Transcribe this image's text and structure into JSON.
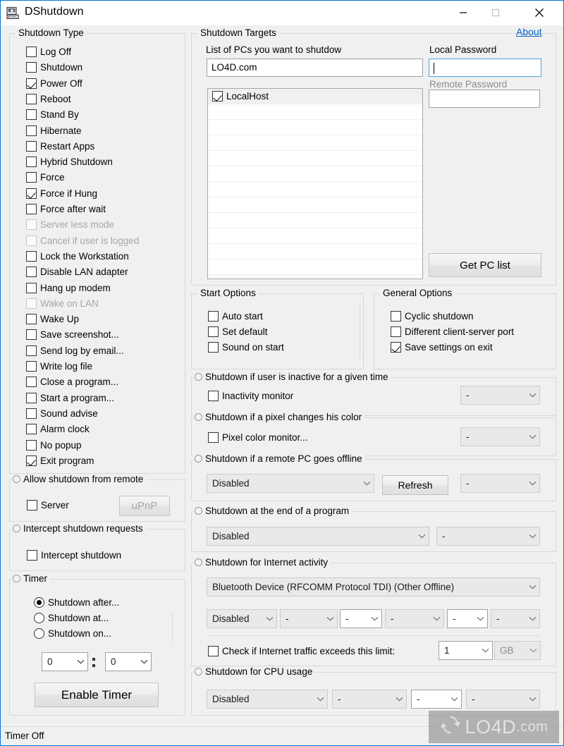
{
  "window": {
    "title": "DShutdown",
    "icon": "computer-icon",
    "minimize_label": "–",
    "maximize_label": "□",
    "close_label": "✕"
  },
  "about_link": "About",
  "shutdown_type": {
    "title": "Shutdown Type",
    "items": [
      {
        "label": "Log Off",
        "checked": false,
        "disabled": false
      },
      {
        "label": "Shutdown",
        "checked": false,
        "disabled": false
      },
      {
        "label": "Power Off",
        "checked": true,
        "disabled": false
      },
      {
        "label": "Reboot",
        "checked": false,
        "disabled": false
      },
      {
        "label": "Stand By",
        "checked": false,
        "disabled": false
      },
      {
        "label": "Hibernate",
        "checked": false,
        "disabled": false
      },
      {
        "label": "Restart Apps",
        "checked": false,
        "disabled": false
      },
      {
        "label": "Hybrid Shutdown",
        "checked": false,
        "disabled": false
      },
      {
        "label": "Force",
        "checked": false,
        "disabled": false
      },
      {
        "label": "Force if Hung",
        "checked": true,
        "disabled": false
      },
      {
        "label": "Force after wait",
        "checked": false,
        "disabled": false
      },
      {
        "label": "Server less mode",
        "checked": false,
        "disabled": true
      },
      {
        "label": "Cancel if user is logged",
        "checked": false,
        "disabled": true
      },
      {
        "label": "Lock the Workstation",
        "checked": false,
        "disabled": false
      },
      {
        "label": "Disable LAN adapter",
        "checked": false,
        "disabled": false
      },
      {
        "label": "Hang up modem",
        "checked": false,
        "disabled": false
      },
      {
        "label": "Wake on LAN",
        "checked": false,
        "disabled": true
      },
      {
        "label": "Wake Up",
        "checked": false,
        "disabled": false
      },
      {
        "label": "Save screenshot...",
        "checked": false,
        "disabled": false
      },
      {
        "label": "Send log by email...",
        "checked": false,
        "disabled": false
      },
      {
        "label": "Write log file",
        "checked": false,
        "disabled": false
      },
      {
        "label": "Close a program...",
        "checked": false,
        "disabled": false
      },
      {
        "label": "Start a program...",
        "checked": false,
        "disabled": false
      },
      {
        "label": "Sound advise",
        "checked": false,
        "disabled": false
      },
      {
        "label": "Alarm clock",
        "checked": false,
        "disabled": false
      },
      {
        "label": "No popup",
        "checked": false,
        "disabled": false
      },
      {
        "label": "Exit program",
        "checked": true,
        "disabled": false
      }
    ]
  },
  "allow_remote": {
    "title": "Allow shutdown from remote",
    "server_label": "Server",
    "server_checked": false,
    "upnp_button": "uPnP",
    "upnp_disabled": true
  },
  "intercept": {
    "title": "Intercept shutdown requests",
    "checkbox_label": "Intercept shutdown",
    "checked": false
  },
  "timer": {
    "title": "Timer",
    "options": [
      {
        "label": "Shutdown after...",
        "selected": true
      },
      {
        "label": "Shutdown at...",
        "selected": false
      },
      {
        "label": "Shutdown on...",
        "selected": false
      }
    ],
    "hours_value": "0",
    "minutes_value": "0",
    "separator": ":",
    "enable_button": "Enable Timer"
  },
  "targets": {
    "title": "Shutdown Targets",
    "list_label": "List of PCs you want to shutdow",
    "pc_input_value": "LO4D.com",
    "local_password_label": "Local Password",
    "local_password_value": "",
    "remote_password_label": "Remote Password",
    "remote_password_value": "",
    "get_pc_list_button": "Get PC list",
    "pc_rows": [
      {
        "label": "LocalHost",
        "checked": true,
        "selected": true
      }
    ],
    "empty_row_count": 11
  },
  "start_options": {
    "title": "Start Options",
    "items": [
      {
        "label": "Auto start",
        "checked": false
      },
      {
        "label": "Set default",
        "checked": false
      },
      {
        "label": "Sound on start",
        "checked": false
      }
    ]
  },
  "general_options": {
    "title": "General Options",
    "items": [
      {
        "label": "Cyclic shutdown",
        "checked": false
      },
      {
        "label": "Different client-server port",
        "checked": false
      },
      {
        "label": "Save settings on exit",
        "checked": true
      }
    ]
  },
  "inactive": {
    "title": "Shutdown if user is inactive for a given time",
    "checkbox_label": "Inactivity monitor",
    "checked": false,
    "combo_value": "-",
    "combo_enabled": false
  },
  "pixel": {
    "title": "Shutdown if a pixel changes his color",
    "checkbox_label": "Pixel color monitor...",
    "checked": false,
    "combo_value": "-",
    "combo_enabled": false
  },
  "remote_pc": {
    "title": "Shutdown if a remote PC goes offline",
    "combo_value": "Disabled",
    "refresh_button": "Refresh",
    "combo2_value": "-",
    "combo2_enabled": false
  },
  "end_program": {
    "title": "Shutdown at the end of a program",
    "combo_value": "Disabled",
    "combo2_value": "-",
    "combo2_enabled": false
  },
  "internet": {
    "title": "Shutdown for Internet activity",
    "adapter_value": "Bluetooth Device (RFCOMM Protocol TDI) (Other Offline)",
    "row_combos": [
      {
        "value": "Disabled",
        "enabled": false
      },
      {
        "value": "-",
        "enabled": false
      },
      {
        "value": "-",
        "enabled": true
      },
      {
        "value": "-",
        "enabled": false
      },
      {
        "value": "-",
        "enabled": true
      },
      {
        "value": "-",
        "enabled": false
      }
    ],
    "limit_checkbox_label": "Check if Internet traffic exceeds this limit:",
    "limit_checked": false,
    "limit_value": "1",
    "limit_unit": "GB"
  },
  "cpu": {
    "title": "Shutdown for CPU usage",
    "row_combos": [
      {
        "value": "Disabled",
        "enabled": false
      },
      {
        "value": "-",
        "enabled": false
      },
      {
        "value": "-",
        "enabled": true
      },
      {
        "value": "-",
        "enabled": false
      }
    ]
  },
  "statusbar": {
    "text": "Timer Off"
  },
  "watermark": {
    "main": "LO4D",
    "sub": ".com",
    "icon": "refresh-arrows-icon"
  },
  "colors": {
    "accent": "#0078d7",
    "link": "#0066cc",
    "window_bg": "#f0f0f0",
    "field_bg": "#ffffff",
    "disabled_text": "#a6a6a6"
  }
}
